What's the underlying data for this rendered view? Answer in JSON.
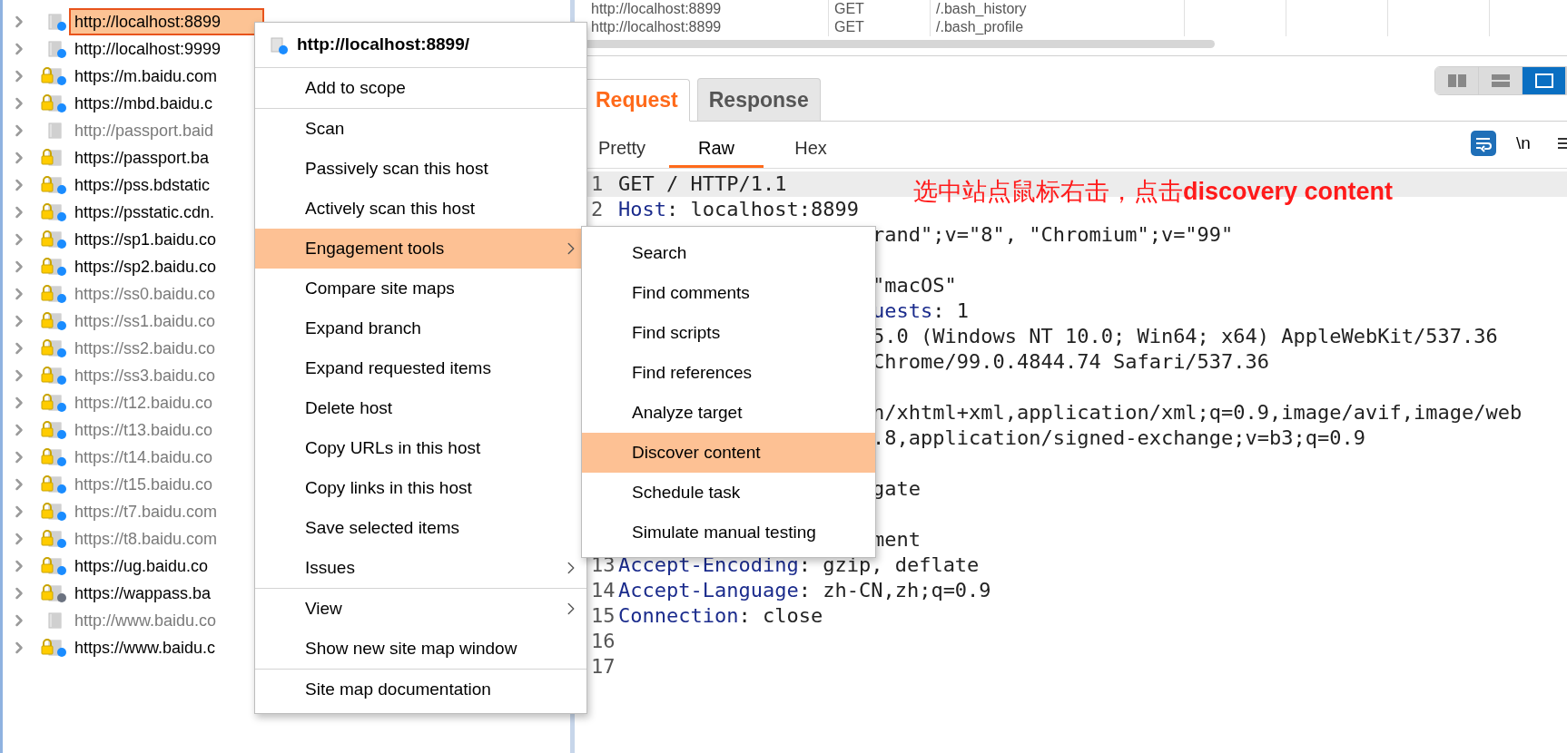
{
  "site_tree": [
    {
      "label": "http://localhost:8899",
      "lock": false,
      "color": "#1a8cff",
      "dimmed": false,
      "selected": true
    },
    {
      "label": "http://localhost:9999",
      "lock": false,
      "color": "#1a8cff",
      "dimmed": false,
      "selected": false
    },
    {
      "label": "https://m.baidu.com",
      "lock": true,
      "color": "#1a8cff",
      "dimmed": false,
      "selected": false
    },
    {
      "label": "https://mbd.baidu.c",
      "lock": true,
      "color": "#1a8cff",
      "dimmed": false,
      "selected": false
    },
    {
      "label": "http://passport.baid",
      "lock": false,
      "dimmed": true,
      "selected": false
    },
    {
      "label": "https://passport.ba",
      "lock": true,
      "dimmed": false,
      "selected": false
    },
    {
      "label": "https://pss.bdstatic",
      "lock": true,
      "color": "#1a8cff",
      "dimmed": false,
      "selected": false
    },
    {
      "label": "https://psstatic.cdn.",
      "lock": true,
      "color": "#1a8cff",
      "dimmed": false,
      "selected": false
    },
    {
      "label": "https://sp1.baidu.co",
      "lock": true,
      "color": "#1a8cff",
      "dimmed": false,
      "selected": false
    },
    {
      "label": "https://sp2.baidu.co",
      "lock": true,
      "color": "#1a8cff",
      "dimmed": false,
      "selected": false
    },
    {
      "label": "https://ss0.baidu.co",
      "lock": true,
      "color": "#1a8cff",
      "dimmed": true,
      "selected": false
    },
    {
      "label": "https://ss1.baidu.co",
      "lock": true,
      "color": "#1a8cff",
      "dimmed": true,
      "selected": false
    },
    {
      "label": "https://ss2.baidu.co",
      "lock": true,
      "color": "#1a8cff",
      "dimmed": true,
      "selected": false
    },
    {
      "label": "https://ss3.baidu.co",
      "lock": true,
      "color": "#1a8cff",
      "dimmed": true,
      "selected": false
    },
    {
      "label": "https://t12.baidu.co",
      "lock": true,
      "color": "#1a8cff",
      "dimmed": true,
      "selected": false
    },
    {
      "label": "https://t13.baidu.co",
      "lock": true,
      "color": "#1a8cff",
      "dimmed": true,
      "selected": false
    },
    {
      "label": "https://t14.baidu.co",
      "lock": true,
      "color": "#1a8cff",
      "dimmed": true,
      "selected": false
    },
    {
      "label": "https://t15.baidu.co",
      "lock": true,
      "color": "#1a8cff",
      "dimmed": true,
      "selected": false
    },
    {
      "label": "https://t7.baidu.com",
      "lock": true,
      "color": "#1a8cff",
      "dimmed": true,
      "selected": false
    },
    {
      "label": "https://t8.baidu.com",
      "lock": true,
      "color": "#1a8cff",
      "dimmed": true,
      "selected": false
    },
    {
      "label": "https://ug.baidu.co",
      "lock": true,
      "color": "#1a8cff",
      "dimmed": false,
      "selected": false
    },
    {
      "label": "https://wappass.ba",
      "lock": true,
      "color": "#6b7280",
      "dimmed": false,
      "selected": false
    },
    {
      "label": "http://www.baidu.co",
      "lock": false,
      "dimmed": true,
      "selected": false
    },
    {
      "label": "https://www.baidu.c",
      "lock": true,
      "color": "#1a8cff",
      "dimmed": false,
      "selected": false
    }
  ],
  "context_menu": {
    "header": "http://localhost:8899/",
    "groups": [
      [
        {
          "label": "Add to scope",
          "submenu": false,
          "selected": false
        }
      ],
      [
        {
          "label": "Scan",
          "submenu": false,
          "selected": false
        },
        {
          "label": "Passively scan this host",
          "submenu": false,
          "selected": false
        },
        {
          "label": "Actively scan this host",
          "submenu": false,
          "selected": false
        },
        {
          "label": "Engagement tools",
          "submenu": true,
          "selected": true
        },
        {
          "label": "Compare site maps",
          "submenu": false,
          "selected": false
        },
        {
          "label": "Expand branch",
          "submenu": false,
          "selected": false
        },
        {
          "label": "Expand requested items",
          "submenu": false,
          "selected": false
        },
        {
          "label": "Delete host",
          "submenu": false,
          "selected": false
        },
        {
          "label": "Copy URLs in this host",
          "submenu": false,
          "selected": false
        },
        {
          "label": "Copy links in this host",
          "submenu": false,
          "selected": false
        },
        {
          "label": "Save selected items",
          "submenu": false,
          "selected": false
        },
        {
          "label": "Issues",
          "submenu": true,
          "selected": false
        }
      ],
      [
        {
          "label": "View",
          "submenu": true,
          "selected": false
        },
        {
          "label": "Show new site map window",
          "submenu": false,
          "selected": false
        }
      ],
      [
        {
          "label": "Site map documentation",
          "submenu": false,
          "selected": false
        }
      ]
    ]
  },
  "submenu": [
    {
      "label": "Search",
      "selected": false
    },
    {
      "label": "Find comments",
      "selected": false
    },
    {
      "label": "Find scripts",
      "selected": false
    },
    {
      "label": "Find references",
      "selected": false
    },
    {
      "label": "Analyze target",
      "selected": false
    },
    {
      "label": "Discover content",
      "selected": true
    },
    {
      "label": "Schedule task",
      "selected": false
    },
    {
      "label": "Simulate manual testing",
      "selected": false
    }
  ],
  "table": {
    "rows": [
      {
        "url": "http://localhost:8899",
        "method": "GET",
        "path": "/.bash_history"
      },
      {
        "url": "http://localhost:8899",
        "method": "GET",
        "path": "/.bash_profile"
      }
    ]
  },
  "layout_buttons": [
    {
      "kind": "columns",
      "selected": false
    },
    {
      "kind": "rows",
      "selected": false
    },
    {
      "kind": "single",
      "selected": true
    }
  ],
  "tabs": [
    {
      "label": "Request",
      "selected": true
    },
    {
      "label": "Response",
      "selected": false
    }
  ],
  "view_tabs": [
    {
      "label": "Pretty",
      "selected": false
    },
    {
      "label": "Raw",
      "selected": true
    },
    {
      "label": "Hex",
      "selected": false
    }
  ],
  "newline_toggle": "\\n",
  "editor_lines": [
    {
      "number": "1",
      "text": "GET / HTTP/1.1",
      "current": true
    },
    {
      "number": "2",
      "key": "Host",
      "text": ": localhost:8899",
      "current": false
    },
    {
      "covered": true,
      "text": "rand\";v=\"8\", \"Chromium\";v=\"99\"",
      "current": false
    },
    {
      "covered": true,
      "current": false
    },
    {
      "covered": true,
      "text": "\"macOS\"",
      "current": false
    },
    {
      "covered": true,
      "key": "uests",
      "text": ": 1",
      "current": false
    },
    {
      "covered": true,
      "text": "5.0 (Windows NT 10.0; Win64; x64) AppleWebKit/537.36",
      "current": false
    },
    {
      "covered": true,
      "text": "Chrome/99.0.4844.74 Safari/537.36",
      "current": false
    },
    {
      "covered": true,
      "current": false
    },
    {
      "covered": true,
      "text": "n/xhtml+xml,application/xml;q=0.9,image/avif,image/web",
      "current": false
    },
    {
      "covered": true,
      "text": ".8,application/signed-exchange;v=b3;q=0.9",
      "current": false
    },
    {
      "covered": true,
      "current": false
    },
    {
      "covered": true,
      "text": "gate",
      "current": false
    },
    {
      "covered": true,
      "current": false
    },
    {
      "covered": true,
      "text": "ment",
      "current": false
    },
    {
      "number": "13",
      "key": "Accept-Encoding",
      "text": ": gzip, deflate",
      "current": false
    },
    {
      "number": "14",
      "key": "Accept-Language",
      "text": ": zh-CN,zh;q=0.9",
      "current": false
    },
    {
      "number": "15",
      "key": "Connection",
      "text": ": close",
      "current": false
    },
    {
      "number": "16",
      "current": false
    },
    {
      "number": "17",
      "current": false
    }
  ],
  "annotation": "选中站点鼠标右击，点击**discovery content**"
}
